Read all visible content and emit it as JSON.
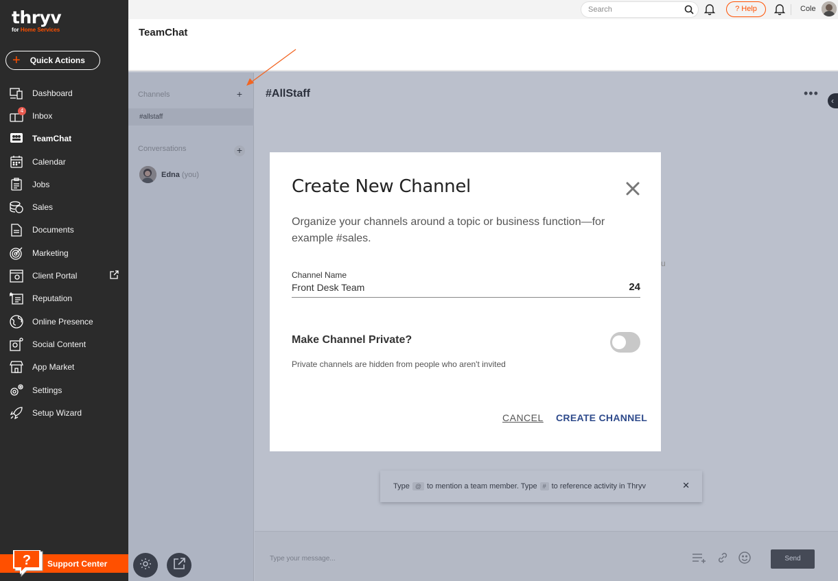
{
  "brand": {
    "logo_text": "thryv",
    "logo_sub_prefix": "for ",
    "logo_sub_highlight": "Home Services"
  },
  "quick_actions": {
    "label": "Quick Actions"
  },
  "nav": {
    "items": [
      {
        "label": "Dashboard",
        "icon": "dashboard-icon"
      },
      {
        "label": "Inbox",
        "icon": "inbox-icon",
        "badge": "4"
      },
      {
        "label": "TeamChat",
        "icon": "teamchat-icon",
        "active": true
      },
      {
        "label": "Calendar",
        "icon": "calendar-icon"
      },
      {
        "label": "Jobs",
        "icon": "jobs-icon"
      },
      {
        "label": "Sales",
        "icon": "sales-icon"
      },
      {
        "label": "Documents",
        "icon": "documents-icon"
      },
      {
        "label": "Marketing",
        "icon": "marketing-icon"
      },
      {
        "label": "Client Portal",
        "icon": "client-portal-icon"
      },
      {
        "label": "Reputation",
        "icon": "reputation-icon"
      },
      {
        "label": "Online Presence",
        "icon": "online-presence-icon"
      },
      {
        "label": "Social Content",
        "icon": "social-content-icon"
      },
      {
        "label": "App Market",
        "icon": "app-market-icon"
      },
      {
        "label": "Settings",
        "icon": "settings-icon"
      },
      {
        "label": "Setup Wizard",
        "icon": "setup-wizard-icon"
      }
    ]
  },
  "support": {
    "label": "Support Center"
  },
  "topbar": {
    "search_placeholder": "Search",
    "help_label": "? Help",
    "user_name": "Cole"
  },
  "page": {
    "title": "TeamChat"
  },
  "channels_panel": {
    "channels_label": "Channels",
    "channels": [
      "#allstaff"
    ],
    "conversations_label": "Conversations",
    "conversation": {
      "name": "Edna",
      "suffix": "(you)"
    }
  },
  "chat": {
    "channel_title": "#AllStaff",
    "more_label": "•••",
    "faint_text": "u",
    "hint": {
      "part1": "Type",
      "key1": "@",
      "part2": "to mention a team member. Type",
      "key2": "#",
      "part3": "to reference activity in Thryv",
      "close": "✕"
    },
    "composer_placeholder": "Type your message...",
    "send_label": "Send"
  },
  "modal": {
    "title": "Create New Channel",
    "description": "Organize your channels around a topic or business function—for example #sales.",
    "field_label": "Channel Name",
    "field_value": "Front Desk Team",
    "char_count": "24",
    "private_label": "Make Channel Private?",
    "private_enabled": false,
    "private_help": "Private channels are hidden from people who aren't invited",
    "cancel_label": "CANCEL",
    "create_label": "CREATE CHANNEL"
  },
  "colors": {
    "brand_orange": "#ff5000",
    "sidebar_bg": "#2b2b2b",
    "link_blue": "#2e4a8b"
  }
}
